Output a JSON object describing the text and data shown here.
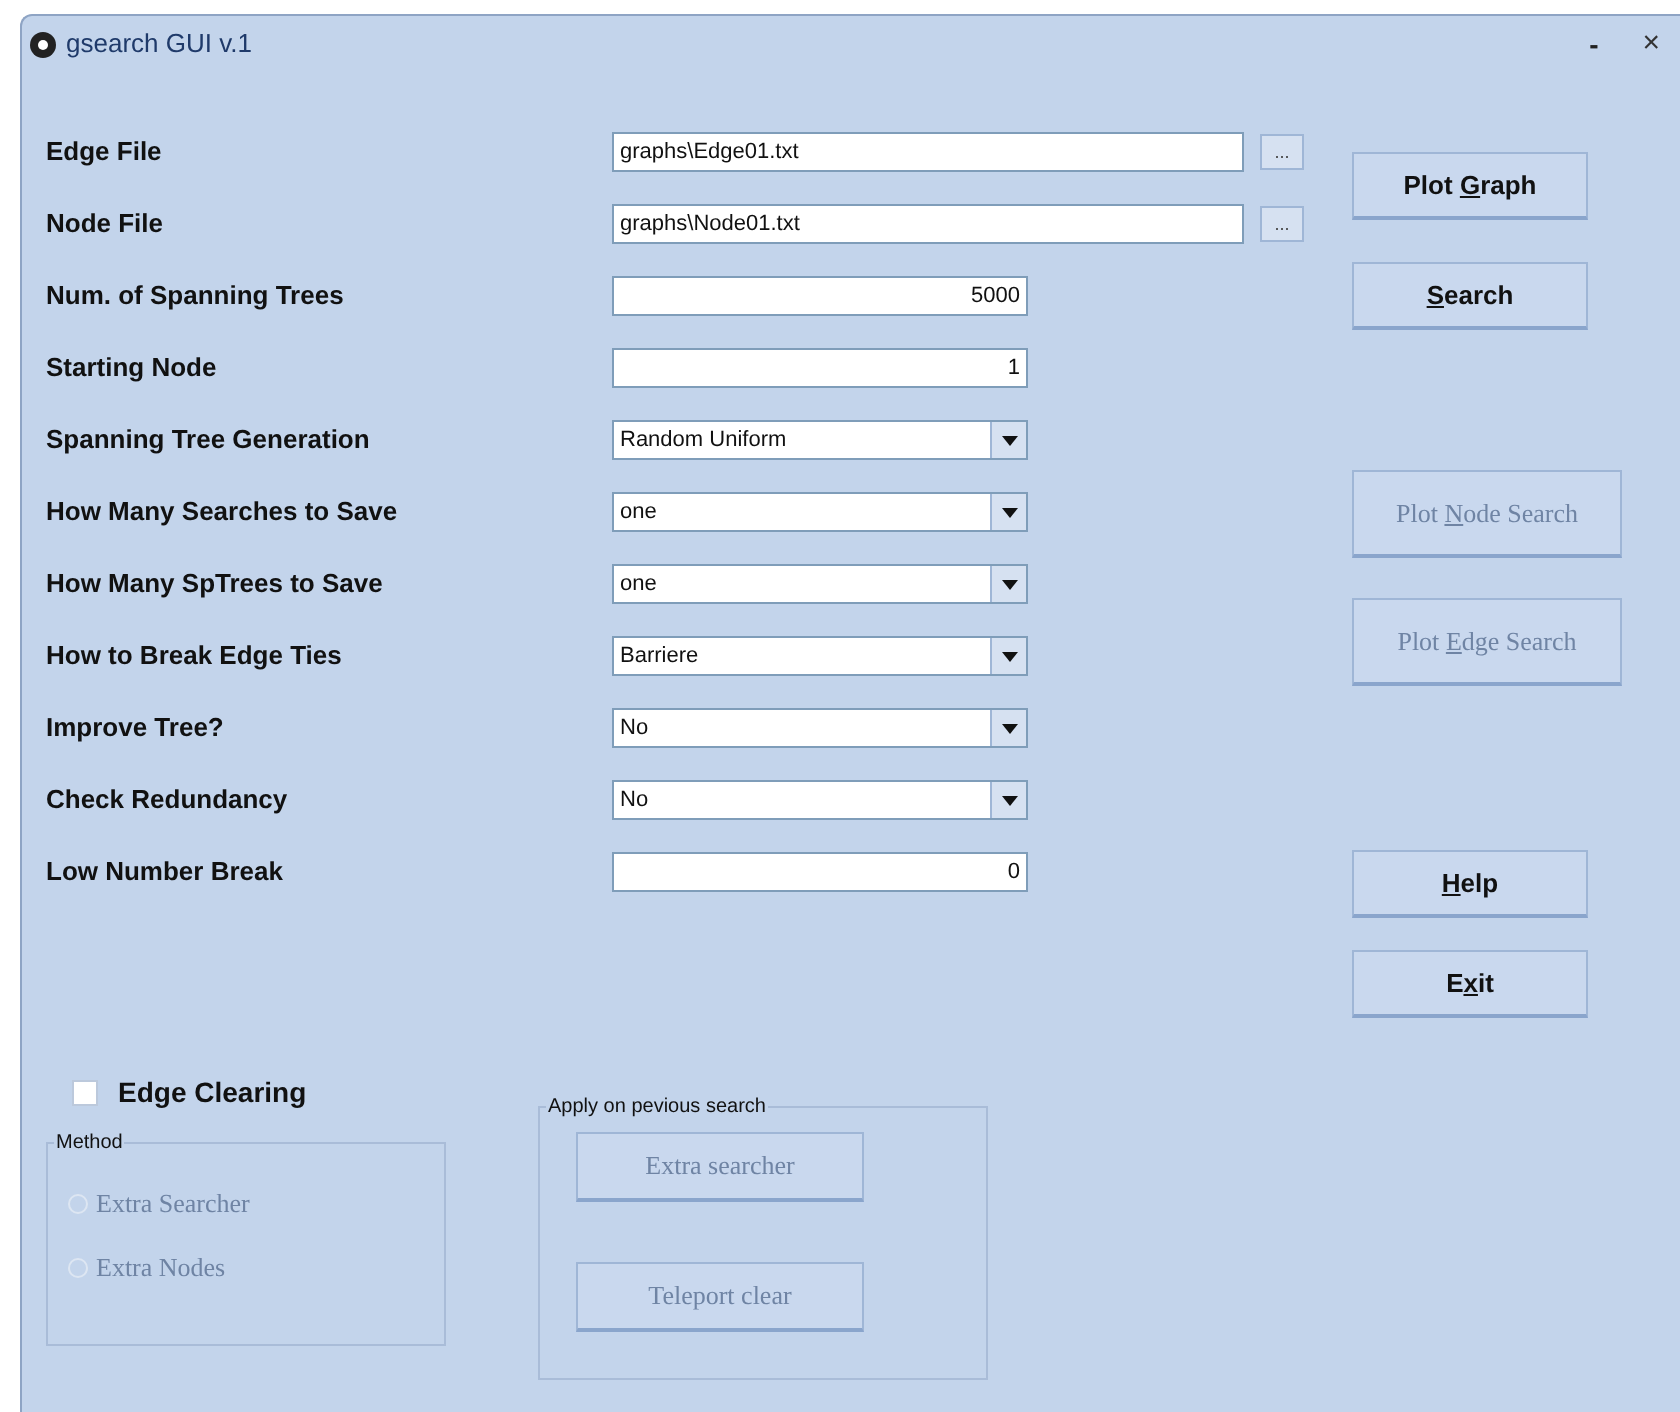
{
  "window": {
    "title": "gsearch GUI v.1",
    "minimize": "-",
    "close": "×"
  },
  "fields": [
    {
      "label": "Edge File",
      "kind": "path",
      "value": "graphs\\Edge01.txt",
      "browse": "..."
    },
    {
      "label": "Node File",
      "kind": "path",
      "value": "graphs\\Node01.txt",
      "browse": "..."
    },
    {
      "label": "Num. of Spanning Trees",
      "kind": "number",
      "value": "5000"
    },
    {
      "label": "Starting Node",
      "kind": "number",
      "value": "1"
    },
    {
      "label": "Spanning Tree Generation",
      "kind": "select",
      "value": "Random Uniform"
    },
    {
      "label": "How Many Searches to Save",
      "kind": "select",
      "value": "one"
    },
    {
      "label": "How Many SpTrees to Save",
      "kind": "select",
      "value": "one"
    },
    {
      "label": "How to Break Edge Ties",
      "kind": "select",
      "value": "Barriere"
    },
    {
      "label": "Improve Tree?",
      "kind": "select",
      "value": "No"
    },
    {
      "label": "Check Redundancy",
      "kind": "select",
      "value": "No"
    },
    {
      "label": "Low Number Break",
      "kind": "number",
      "value": "0"
    }
  ],
  "buttons": [
    {
      "pre": "Plot ",
      "key": "G",
      "post": "raph",
      "disabled": false
    },
    {
      "key": "S",
      "post": "earch",
      "disabled": false
    },
    {
      "pre": "Plot ",
      "key": "N",
      "post": "ode Search",
      "disabled": true
    },
    {
      "pre": "Plot ",
      "key": "E",
      "post": "dge Search",
      "disabled": true
    },
    {
      "key": "H",
      "post": "elp",
      "disabled": false
    },
    {
      "pre": "E",
      "key": "x",
      "post": "it",
      "disabled": false
    }
  ],
  "edge_clearing": {
    "label": "Edge Clearing",
    "checked": false
  },
  "method": {
    "title": "Method",
    "options": [
      {
        "label": "Extra Searcher",
        "selected": false,
        "disabled": true
      },
      {
        "label": "Extra Nodes",
        "selected": false,
        "disabled": true
      }
    ]
  },
  "apply": {
    "title": "Apply on pevious search",
    "buttons": [
      {
        "label": "Extra searcher",
        "disabled": true
      },
      {
        "label": "Teleport clear",
        "disabled": true
      }
    ]
  }
}
